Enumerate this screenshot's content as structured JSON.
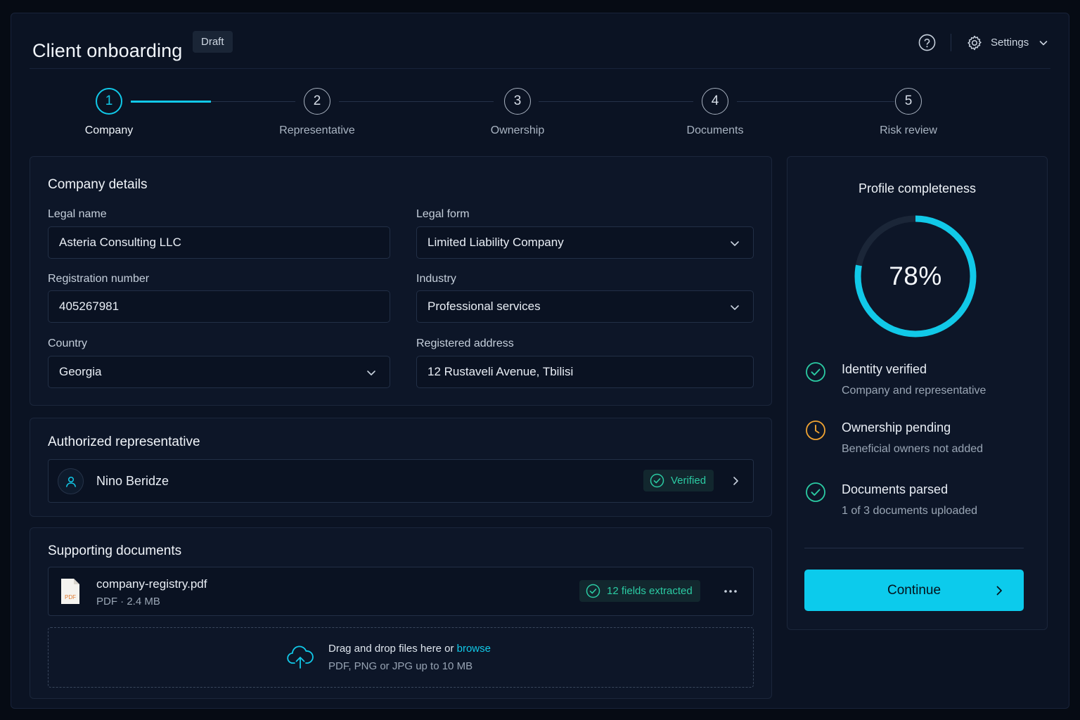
{
  "header": {
    "title": "Client onboarding",
    "status_badge": "Draft",
    "settings_label": "Settings"
  },
  "stepper": {
    "steps": [
      {
        "number": "1",
        "label": "Company",
        "active": true
      },
      {
        "number": "2",
        "label": "Representative",
        "active": false
      },
      {
        "number": "3",
        "label": "Ownership",
        "active": false
      },
      {
        "number": "4",
        "label": "Documents",
        "active": false
      },
      {
        "number": "5",
        "label": "Risk review",
        "active": false
      }
    ]
  },
  "company": {
    "heading": "Company details",
    "legal_name": {
      "label": "Legal name",
      "value": "Asteria Consulting LLC"
    },
    "legal_form": {
      "label": "Legal form",
      "value": "Limited Liability Company"
    },
    "registration_number": {
      "label": "Registration number",
      "value": "405267981"
    },
    "industry": {
      "label": "Industry",
      "value": "Professional services"
    },
    "country": {
      "label": "Country",
      "value": "Georgia"
    },
    "registered_address": {
      "label": "Registered address",
      "value": "12 Rustaveli Avenue, Tbilisi"
    }
  },
  "representative": {
    "heading": "Authorized representative",
    "name": "Nino Beridze",
    "badge": "Verified"
  },
  "documents": {
    "heading": "Supporting documents",
    "file": {
      "name": "company-registry.pdf",
      "meta": "PDF · 2.4 MB",
      "type_label": "PDF",
      "badge": "12 fields extracted"
    },
    "dropzone": {
      "text": "Drag and drop files here or",
      "link": "browse",
      "hint": "PDF, PNG or JPG up to 10 MB"
    }
  },
  "completeness": {
    "title": "Profile completeness",
    "percent_label": "78%",
    "percent": 78,
    "items": [
      {
        "title": "Identity verified",
        "subtitle": "Company and representative",
        "state": "done",
        "icon": "check-circle-icon"
      },
      {
        "title": "Ownership pending",
        "subtitle": "Beneficial owners not added",
        "state": "pending",
        "icon": "clock-icon"
      },
      {
        "title": "Documents parsed",
        "subtitle": "1 of 3 documents uploaded",
        "state": "done",
        "icon": "check-circle-icon"
      }
    ],
    "continue_label": "Continue"
  },
  "colors": {
    "accent": "#11c9e8",
    "success": "#2bcba3",
    "warning": "#f0a332",
    "background": "#0b1323"
  }
}
